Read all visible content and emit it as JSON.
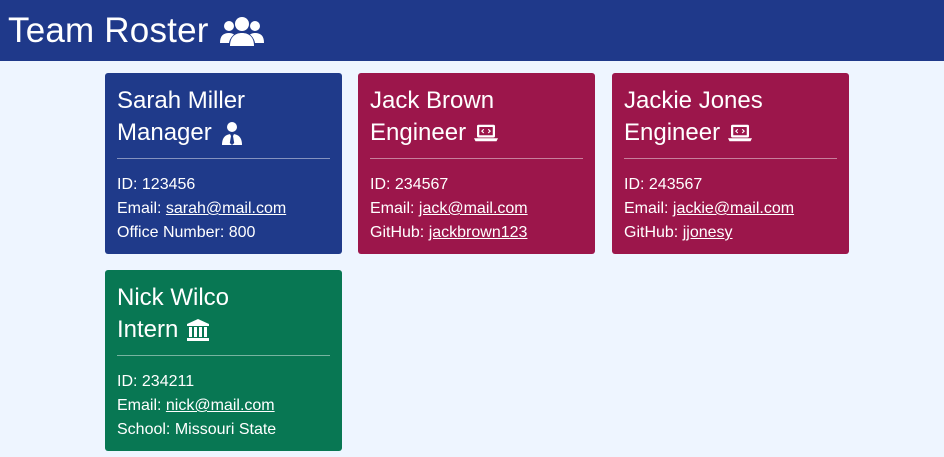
{
  "header": {
    "title": "Team Roster",
    "icon": "users-icon"
  },
  "colors": {
    "header": "#1f398a",
    "manager": "#1f3a8a",
    "engineer": "#9c164b",
    "intern": "#087753",
    "background": "#eef5ff"
  },
  "cards": [
    {
      "name": "Sarah Miller",
      "role": "Manager",
      "role_icon": "manager-icon",
      "id_label": "ID:",
      "id": "123456",
      "email_label": "Email:",
      "email": "sarah@mail.com",
      "extra_label": "Office Number:",
      "extra": "800"
    },
    {
      "name": "Jack Brown",
      "role": "Engineer",
      "role_icon": "laptop-code-icon",
      "id_label": "ID:",
      "id": "234567",
      "email_label": "Email:",
      "email": "jack@mail.com",
      "extra_label": "GitHub:",
      "extra": "jackbrown123"
    },
    {
      "name": "Jackie Jones",
      "role": "Engineer",
      "role_icon": "laptop-code-icon",
      "id_label": "ID:",
      "id": "243567",
      "email_label": "Email:",
      "email": "jackie@mail.com",
      "extra_label": "GitHub:",
      "extra": "jjonesy"
    },
    {
      "name": "Nick Wilco",
      "role": "Intern",
      "role_icon": "university-icon",
      "id_label": "ID:",
      "id": "234211",
      "email_label": "Email:",
      "email": "nick@mail.com",
      "extra_label": "School:",
      "extra": "Missouri State"
    }
  ]
}
